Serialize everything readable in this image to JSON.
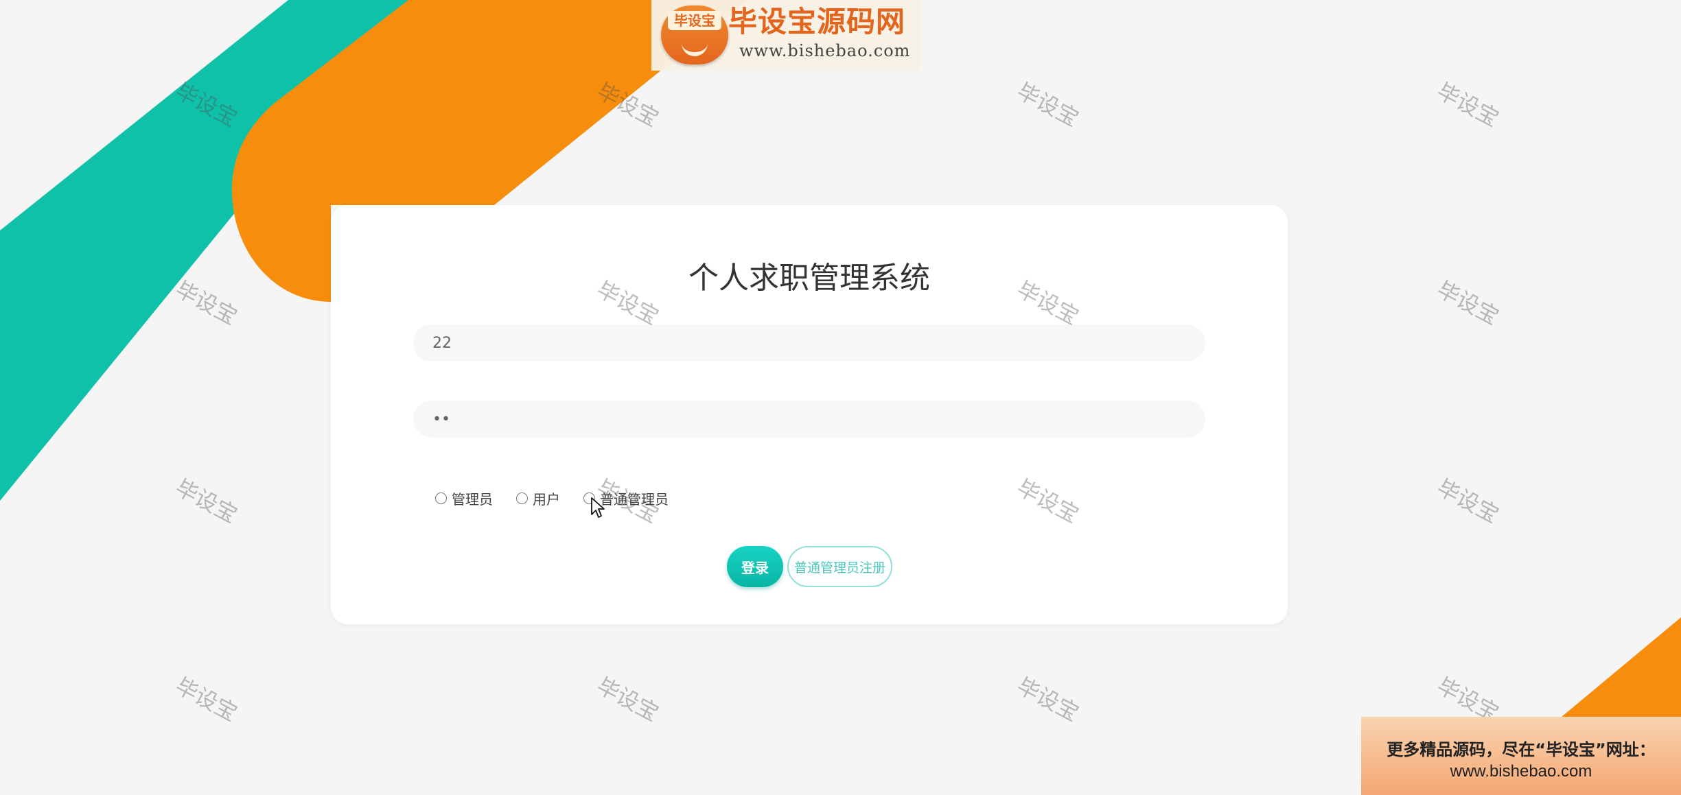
{
  "colors": {
    "teal": "#10c1aa",
    "orange": "#f68d0c",
    "background": "#f5f5f5",
    "button_primary": "#14c8b8",
    "button_outline": "#8fe0d8"
  },
  "branding": {
    "logo_badge": "毕设宝",
    "logo_title": "毕设宝源码网",
    "logo_url": "www.bishebao.com",
    "watermark_text": "毕设宝"
  },
  "login": {
    "title": "个人求职管理系统",
    "username_value": "22",
    "password_value": "••",
    "roles": [
      {
        "label": "管理员",
        "selected": false
      },
      {
        "label": "用户",
        "selected": false
      },
      {
        "label": "普通管理员",
        "selected": false
      }
    ],
    "login_button": "登录",
    "register_button": "普通管理员注册"
  },
  "promo": {
    "line1": "更多精品源码，尽在“毕设宝”网址：",
    "line2": "www.bishebao.com"
  }
}
